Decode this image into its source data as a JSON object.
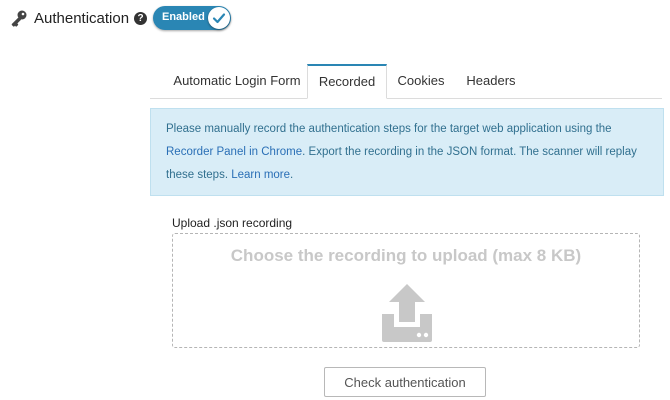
{
  "header": {
    "title": "Authentication",
    "help_glyph": "?",
    "key_icon": "key-icon",
    "toggle": {
      "label": "Enabled",
      "state": "on",
      "color": "#2a86b4"
    }
  },
  "tabs": [
    {
      "label": "Automatic Login Form",
      "active": false
    },
    {
      "label": "Recorded",
      "active": true
    },
    {
      "label": "Cookies",
      "active": false
    },
    {
      "label": "Headers",
      "active": false
    }
  ],
  "info": {
    "text_1": "Please manually record the authentication steps for the target web application using the ",
    "link_1": "Recorder Panel in Chrome",
    "text_2": ". Export the recording in the JSON format. The scanner will replay these steps. ",
    "link_2": "Learn more",
    "text_3": "."
  },
  "upload": {
    "label": "Upload .json recording",
    "dropzone_text": "Choose the recording to upload (max 8 KB)",
    "icon": "upload-icon"
  },
  "actions": {
    "check_label": "Check authentication"
  }
}
